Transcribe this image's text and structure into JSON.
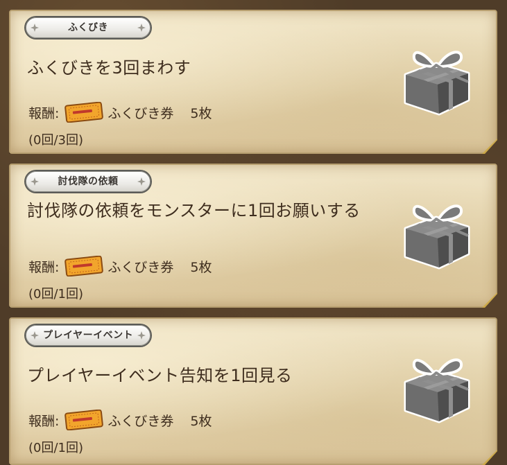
{
  "missions": [
    {
      "category": "ふくびき",
      "title": "ふくびきを3回まわす",
      "reward_label": "報酬:",
      "reward_item": "ふくびき券",
      "reward_amount": "5枚",
      "progress": "(0回/3回)",
      "reward_icon": "ticket-icon",
      "gift_icon": "gift-box-icon"
    },
    {
      "category": "討伐隊の依頼",
      "title": "討伐隊の依頼をモンスターに1回お願いする",
      "reward_label": "報酬:",
      "reward_item": "ふくびき券",
      "reward_amount": "5枚",
      "progress": "(0回/1回)",
      "reward_icon": "ticket-icon",
      "gift_icon": "gift-box-icon"
    },
    {
      "category": "プレイヤーイベント",
      "title": "プレイヤーイベント告知を1回見る",
      "reward_label": "報酬:",
      "reward_item": "ふくびき券",
      "reward_amount": "5枚",
      "progress": "(0回/1回)",
      "reward_icon": "ticket-icon",
      "gift_icon": "gift-box-icon"
    }
  ],
  "colors": {
    "parchment": "#e6d6b0",
    "text": "#3e2d1e",
    "ticket": "#f2a52c",
    "gift": "#6a6a6a"
  }
}
